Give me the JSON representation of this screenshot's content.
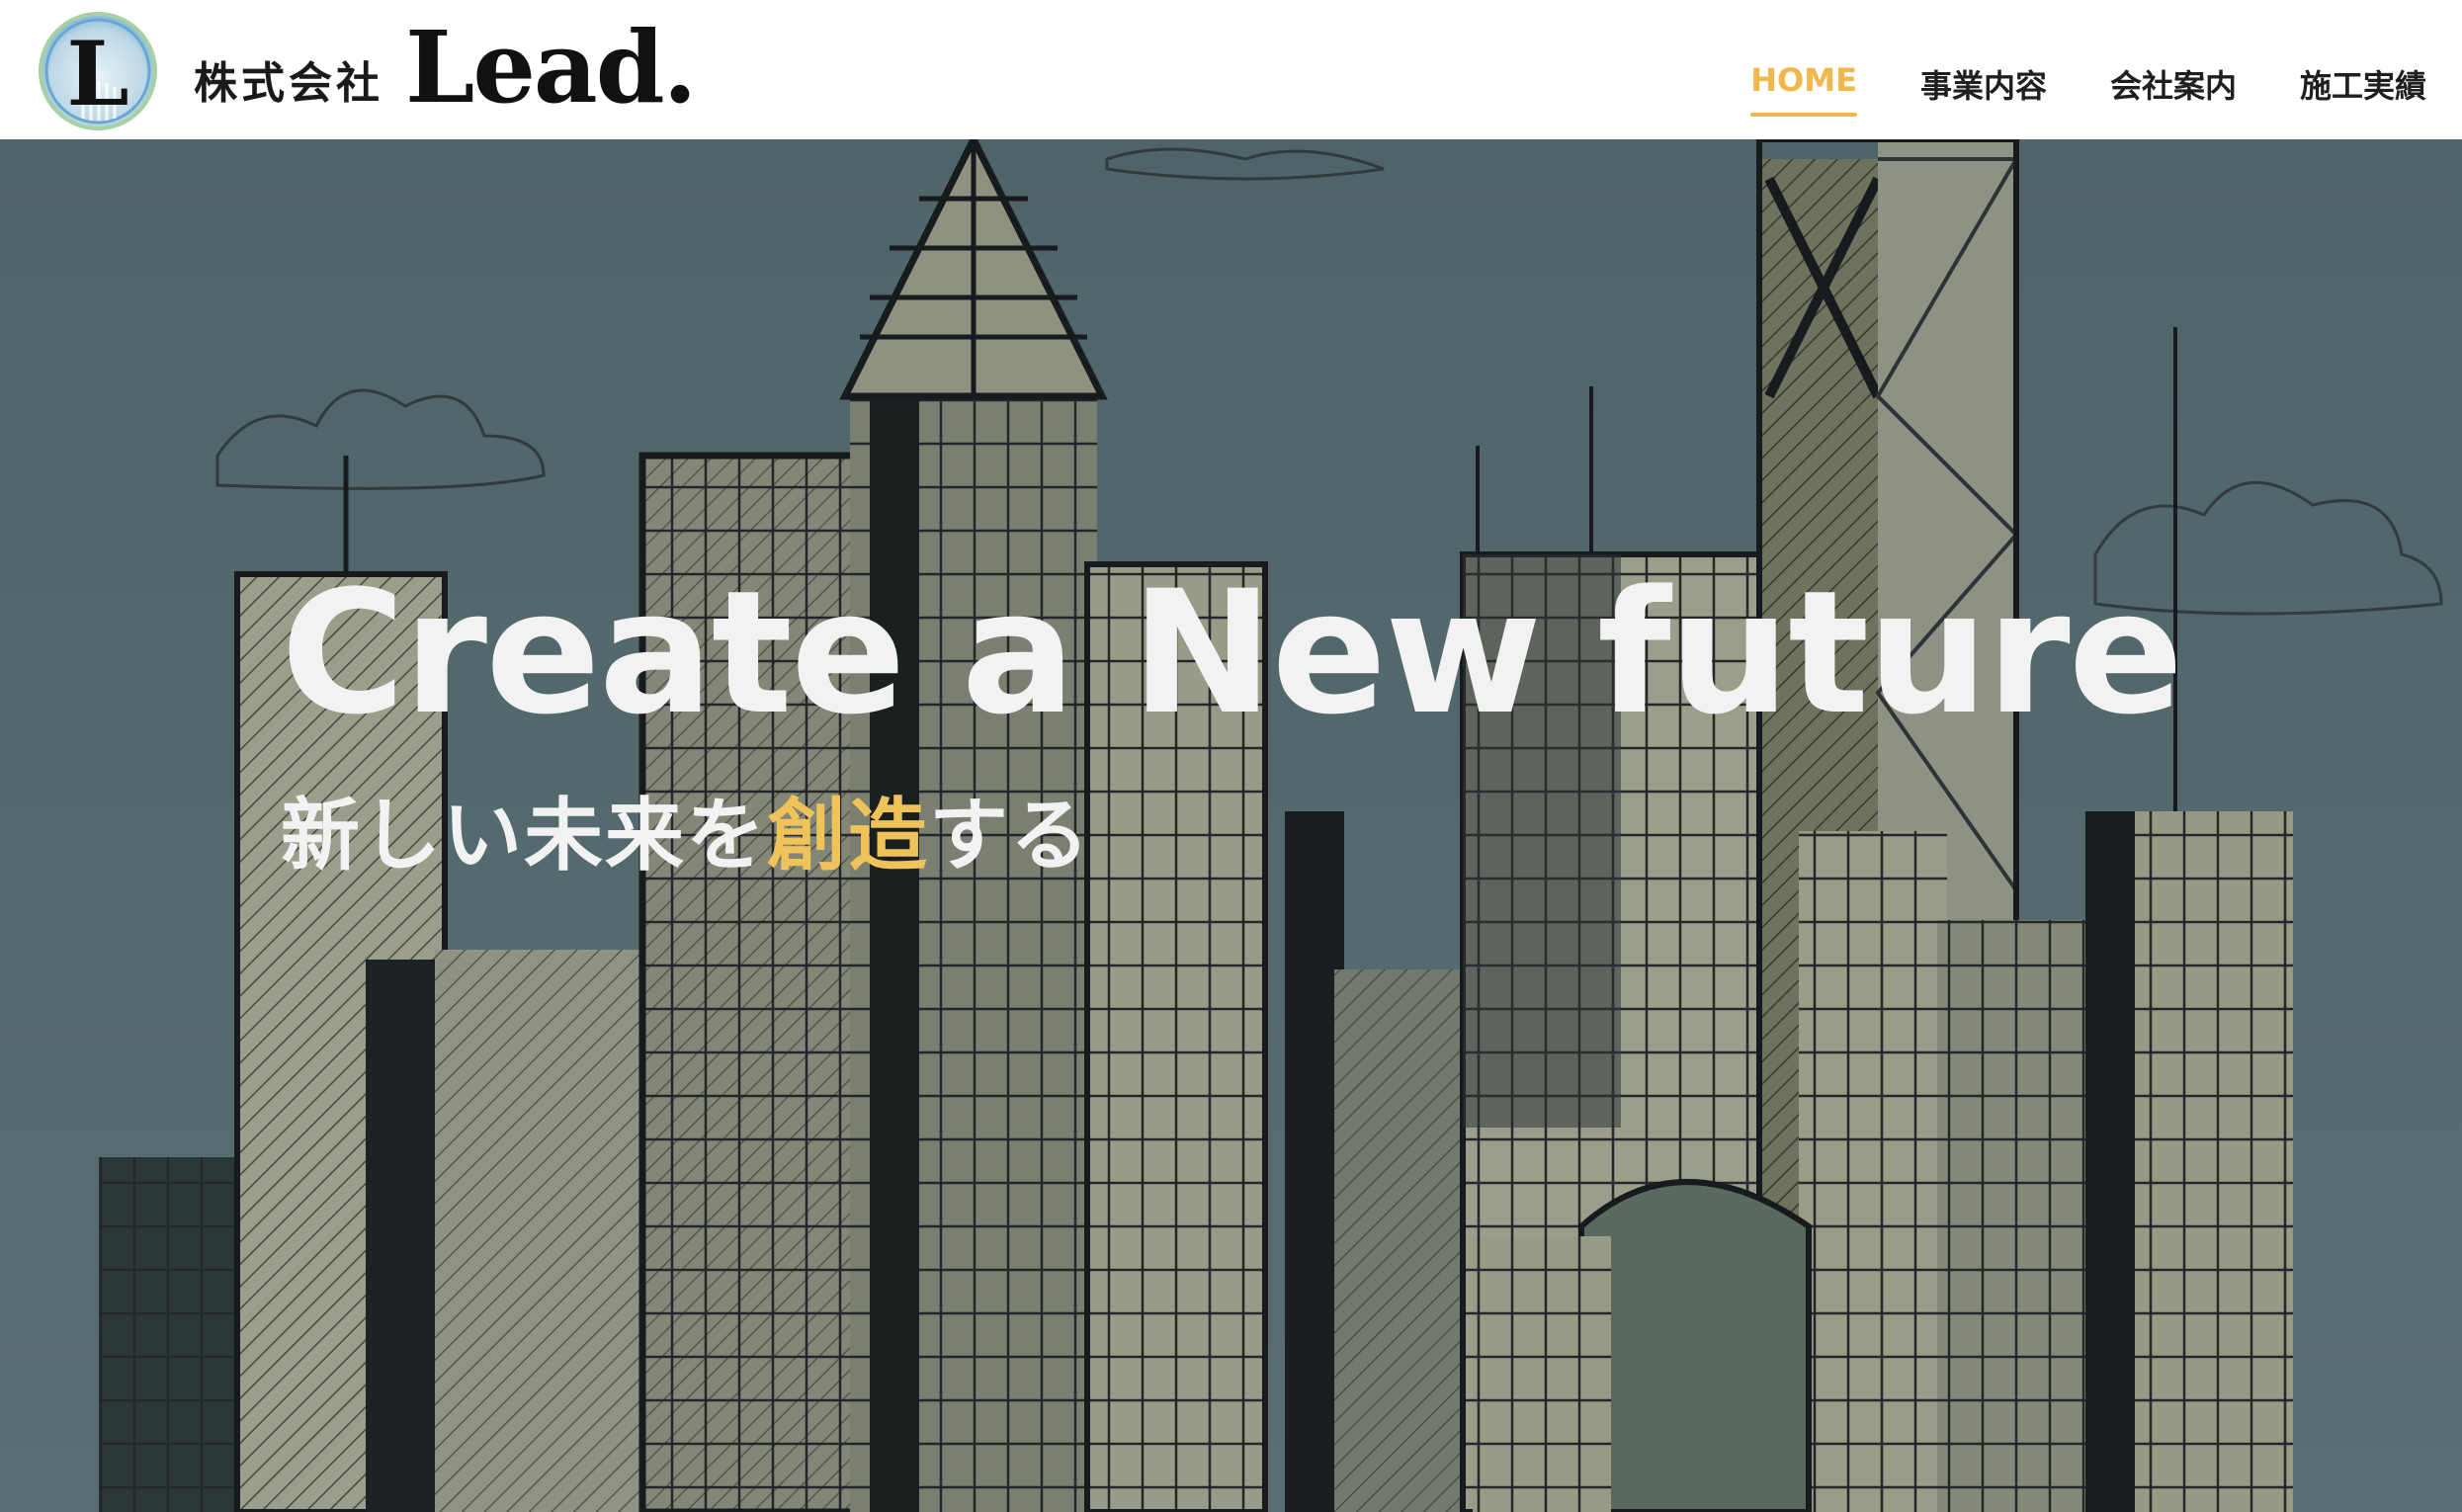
{
  "header": {
    "company_jp": "株式会社",
    "company_en": "Lead.",
    "emblem_letter": "L"
  },
  "nav": {
    "items": [
      {
        "label": "HOME",
        "active": true
      },
      {
        "label": "事業内容",
        "active": false
      },
      {
        "label": "会社案内",
        "active": false
      },
      {
        "label": "施工実績",
        "active": false
      }
    ]
  },
  "hero": {
    "headline": "Create a New future",
    "sub_before": "新しい未来を",
    "sub_accent": "創造",
    "sub_after": "する"
  },
  "colors": {
    "accent": "#f0b84a",
    "sky": "#5d7479",
    "text_light": "#f2f2f2"
  }
}
